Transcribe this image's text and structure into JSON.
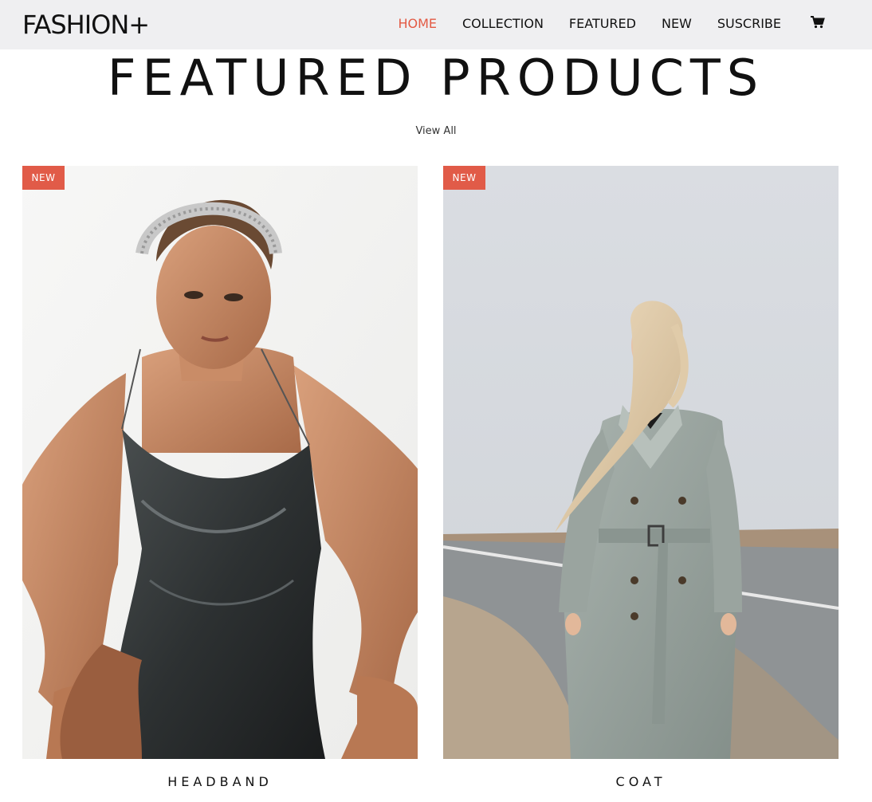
{
  "nav": {
    "brand": "FASHION+",
    "links": [
      "HOME",
      "COLLECTION",
      "FEATURED",
      "NEW",
      "SUSCRIBE"
    ],
    "active": "HOME",
    "cart_icon": "cart-icon"
  },
  "hero": {
    "title": "FEATURED PRODUCTS",
    "view_all": "View All"
  },
  "products": [
    {
      "badge": "NEW",
      "name": "HEADBAND"
    },
    {
      "badge": "NEW",
      "name": "COAT"
    }
  ],
  "colors": {
    "accent": "#e35a44",
    "badge": "#e15b48",
    "navbar_bg": "#efeff1"
  }
}
